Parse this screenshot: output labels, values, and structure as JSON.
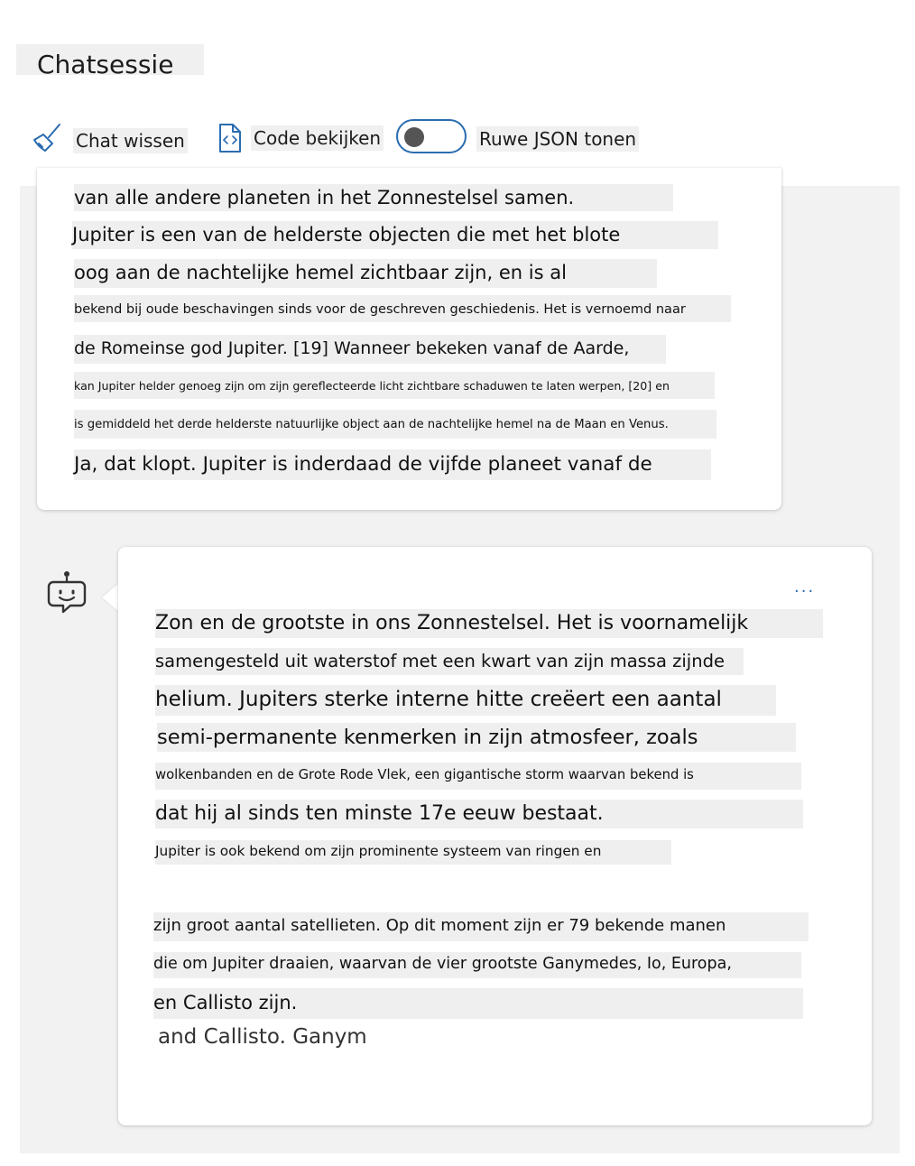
{
  "header": {
    "title": "Chatsessie"
  },
  "toolbar": {
    "clear_label": "Chat wissen",
    "code_label": "Code bekijken",
    "json_label": "Ruwe JSON tonen",
    "json_toggle_on": false,
    "clear_icon": "broom-icon",
    "code_icon": "code-file-icon"
  },
  "previous_message": {
    "lines": [
      "van alle andere planeten in het Zonnestelsel samen.",
      "Jupiter is een van de helderste objecten die met het blote",
      "oog aan de nachtelijke hemel zichtbaar zijn, en is al",
      "bekend bij oude beschavingen sinds voor de geschreven geschiedenis. Het is vernoemd naar",
      "de Romeinse god Jupiter. [19] Wanneer bekeken vanaf de Aarde,",
      "kan Jupiter helder genoeg zijn om zijn gereflecteerde licht zichtbare schaduwen te laten werpen, [20] en",
      "is gemiddeld het derde helderste natuurlijke object aan de nachtelijke hemel na de Maan en Venus.",
      "Ja, dat klopt. Jupiter is inderdaad de vijfde planeet vanaf de"
    ]
  },
  "assistant_message": {
    "avatar_icon": "bot-icon",
    "more_label": "...",
    "lines": [
      "Zon en de grootste in ons Zonnestelsel. Het is voornamelijk",
      "samengesteld uit waterstof met een kwart van zijn massa zijnde",
      "helium. Jupiters sterke interne hitte creëert een aantal",
      "semi-permanente kenmerken in zijn atmosfeer, zoals",
      "wolkenbanden en de Grote Rode Vlek, een gigantische storm waarvan bekend is",
      "dat hij al sinds ten minste 17e eeuw bestaat.",
      "Jupiter is ook bekend om zijn prominente systeem van ringen en",
      "zijn groot aantal satellieten. Op dit moment zijn er 79 bekende manen",
      "die om Jupiter draaien, waarvan de vier grootste Ganymedes, Io, Europa,",
      "en Callisto zijn.",
      "and Callisto. Ganym"
    ]
  },
  "colors": {
    "accent": "#2b6cb0",
    "panel_bg": "#f2f2f2",
    "text_highlight": "#efefef"
  }
}
